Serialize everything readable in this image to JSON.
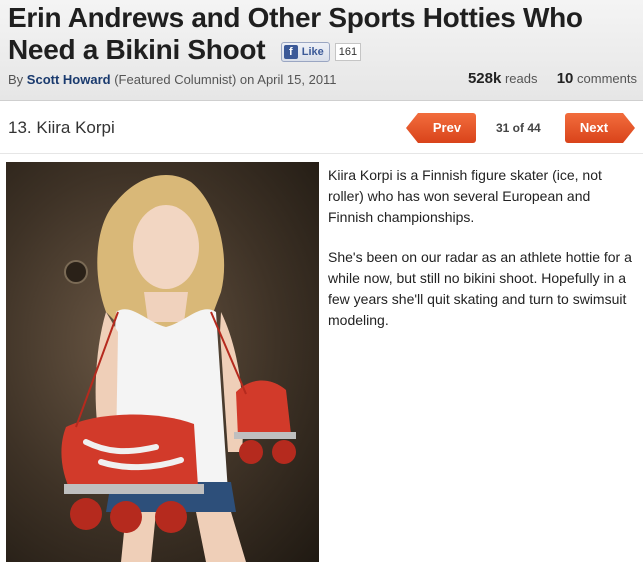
{
  "article": {
    "title": "Erin Andrews and Other Sports Hotties Who Need a Bikini Shoot",
    "facebook": {
      "icon": "facebook-icon",
      "like_label": "Like",
      "like_count": "161"
    },
    "byline": {
      "prefix": "By",
      "author": "Scott Howard",
      "role": "(Featured Columnist) on April 15, 2011"
    },
    "stats": {
      "reads_count": "528k",
      "reads_label": "reads",
      "comments_count": "10",
      "comments_label": "comments"
    }
  },
  "slide": {
    "title": "13. Kiira Korpi",
    "prev_label": "Prev",
    "next_label": "Next",
    "page_indicator": "31 of 44",
    "body": [
      "Kiira Korpi is a Finnish figure skater (ice, not roller) who has won several European and Finnish championships.",
      "She's been on our radar as an athlete hottie for a while now, but still no bikini shoot. Hopefully in a few years she'll quit skating and turn to swimsuit modeling."
    ]
  },
  "colors": {
    "accent": "#e2521f",
    "author_link": "#1a3a6e",
    "facebook": "#3b5998"
  }
}
